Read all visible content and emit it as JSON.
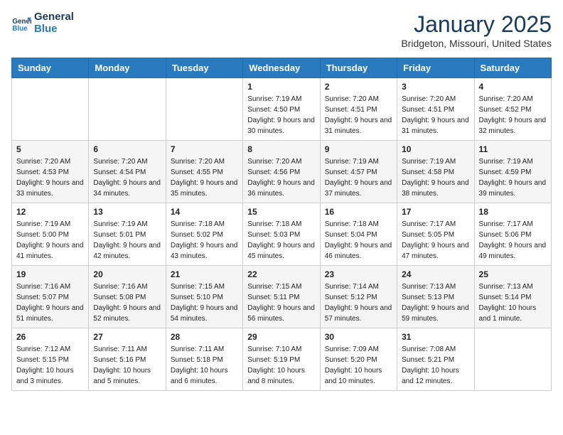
{
  "header": {
    "logo_line1": "General",
    "logo_line2": "Blue",
    "month": "January 2025",
    "location": "Bridgeton, Missouri, United States"
  },
  "weekdays": [
    "Sunday",
    "Monday",
    "Tuesday",
    "Wednesday",
    "Thursday",
    "Friday",
    "Saturday"
  ],
  "weeks": [
    [
      {
        "day": "",
        "info": ""
      },
      {
        "day": "",
        "info": ""
      },
      {
        "day": "",
        "info": ""
      },
      {
        "day": "1",
        "info": "Sunrise: 7:19 AM\nSunset: 4:50 PM\nDaylight: 9 hours and 30 minutes."
      },
      {
        "day": "2",
        "info": "Sunrise: 7:20 AM\nSunset: 4:51 PM\nDaylight: 9 hours and 31 minutes."
      },
      {
        "day": "3",
        "info": "Sunrise: 7:20 AM\nSunset: 4:51 PM\nDaylight: 9 hours and 31 minutes."
      },
      {
        "day": "4",
        "info": "Sunrise: 7:20 AM\nSunset: 4:52 PM\nDaylight: 9 hours and 32 minutes."
      }
    ],
    [
      {
        "day": "5",
        "info": "Sunrise: 7:20 AM\nSunset: 4:53 PM\nDaylight: 9 hours and 33 minutes."
      },
      {
        "day": "6",
        "info": "Sunrise: 7:20 AM\nSunset: 4:54 PM\nDaylight: 9 hours and 34 minutes."
      },
      {
        "day": "7",
        "info": "Sunrise: 7:20 AM\nSunset: 4:55 PM\nDaylight: 9 hours and 35 minutes."
      },
      {
        "day": "8",
        "info": "Sunrise: 7:20 AM\nSunset: 4:56 PM\nDaylight: 9 hours and 36 minutes."
      },
      {
        "day": "9",
        "info": "Sunrise: 7:19 AM\nSunset: 4:57 PM\nDaylight: 9 hours and 37 minutes."
      },
      {
        "day": "10",
        "info": "Sunrise: 7:19 AM\nSunset: 4:58 PM\nDaylight: 9 hours and 38 minutes."
      },
      {
        "day": "11",
        "info": "Sunrise: 7:19 AM\nSunset: 4:59 PM\nDaylight: 9 hours and 39 minutes."
      }
    ],
    [
      {
        "day": "12",
        "info": "Sunrise: 7:19 AM\nSunset: 5:00 PM\nDaylight: 9 hours and 41 minutes."
      },
      {
        "day": "13",
        "info": "Sunrise: 7:19 AM\nSunset: 5:01 PM\nDaylight: 9 hours and 42 minutes."
      },
      {
        "day": "14",
        "info": "Sunrise: 7:18 AM\nSunset: 5:02 PM\nDaylight: 9 hours and 43 minutes."
      },
      {
        "day": "15",
        "info": "Sunrise: 7:18 AM\nSunset: 5:03 PM\nDaylight: 9 hours and 45 minutes."
      },
      {
        "day": "16",
        "info": "Sunrise: 7:18 AM\nSunset: 5:04 PM\nDaylight: 9 hours and 46 minutes."
      },
      {
        "day": "17",
        "info": "Sunrise: 7:17 AM\nSunset: 5:05 PM\nDaylight: 9 hours and 47 minutes."
      },
      {
        "day": "18",
        "info": "Sunrise: 7:17 AM\nSunset: 5:06 PM\nDaylight: 9 hours and 49 minutes."
      }
    ],
    [
      {
        "day": "19",
        "info": "Sunrise: 7:16 AM\nSunset: 5:07 PM\nDaylight: 9 hours and 51 minutes."
      },
      {
        "day": "20",
        "info": "Sunrise: 7:16 AM\nSunset: 5:08 PM\nDaylight: 9 hours and 52 minutes."
      },
      {
        "day": "21",
        "info": "Sunrise: 7:15 AM\nSunset: 5:10 PM\nDaylight: 9 hours and 54 minutes."
      },
      {
        "day": "22",
        "info": "Sunrise: 7:15 AM\nSunset: 5:11 PM\nDaylight: 9 hours and 56 minutes."
      },
      {
        "day": "23",
        "info": "Sunrise: 7:14 AM\nSunset: 5:12 PM\nDaylight: 9 hours and 57 minutes."
      },
      {
        "day": "24",
        "info": "Sunrise: 7:13 AM\nSunset: 5:13 PM\nDaylight: 9 hours and 59 minutes."
      },
      {
        "day": "25",
        "info": "Sunrise: 7:13 AM\nSunset: 5:14 PM\nDaylight: 10 hours and 1 minute."
      }
    ],
    [
      {
        "day": "26",
        "info": "Sunrise: 7:12 AM\nSunset: 5:15 PM\nDaylight: 10 hours and 3 minutes."
      },
      {
        "day": "27",
        "info": "Sunrise: 7:11 AM\nSunset: 5:16 PM\nDaylight: 10 hours and 5 minutes."
      },
      {
        "day": "28",
        "info": "Sunrise: 7:11 AM\nSunset: 5:18 PM\nDaylight: 10 hours and 6 minutes."
      },
      {
        "day": "29",
        "info": "Sunrise: 7:10 AM\nSunset: 5:19 PM\nDaylight: 10 hours and 8 minutes."
      },
      {
        "day": "30",
        "info": "Sunrise: 7:09 AM\nSunset: 5:20 PM\nDaylight: 10 hours and 10 minutes."
      },
      {
        "day": "31",
        "info": "Sunrise: 7:08 AM\nSunset: 5:21 PM\nDaylight: 10 hours and 12 minutes."
      },
      {
        "day": "",
        "info": ""
      }
    ]
  ]
}
